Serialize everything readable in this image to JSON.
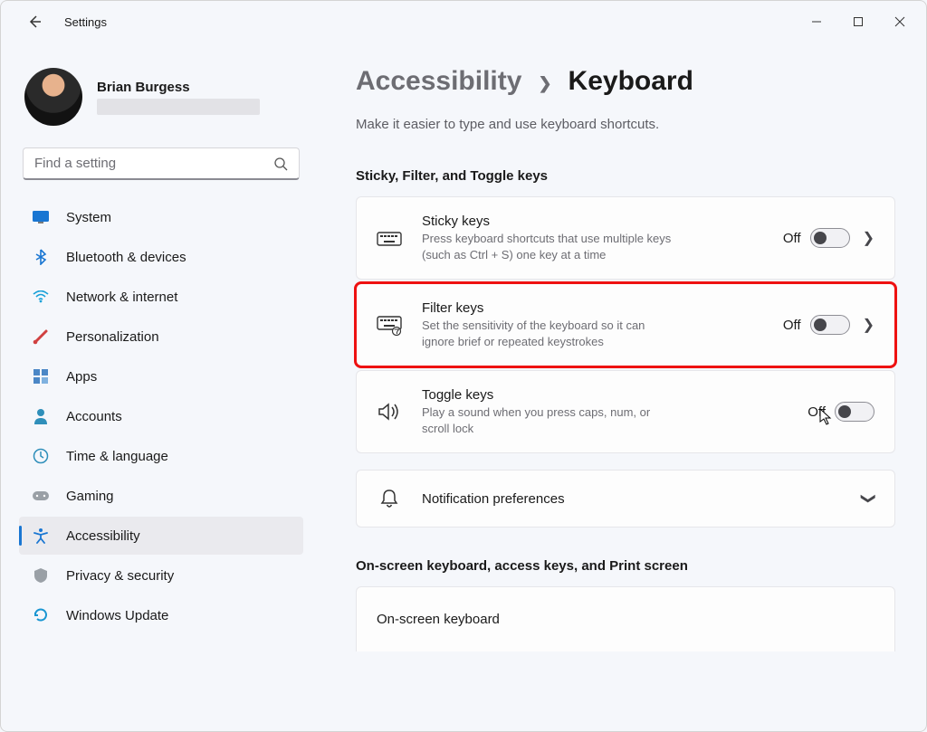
{
  "app_title": "Settings",
  "user": {
    "name": "Brian Burgess"
  },
  "search": {
    "placeholder": "Find a setting"
  },
  "nav": {
    "items": [
      {
        "label": "System"
      },
      {
        "label": "Bluetooth & devices"
      },
      {
        "label": "Network & internet"
      },
      {
        "label": "Personalization"
      },
      {
        "label": "Apps"
      },
      {
        "label": "Accounts"
      },
      {
        "label": "Time & language"
      },
      {
        "label": "Gaming"
      },
      {
        "label": "Accessibility"
      },
      {
        "label": "Privacy & security"
      },
      {
        "label": "Windows Update"
      }
    ]
  },
  "breadcrumb": {
    "prev": "Accessibility",
    "current": "Keyboard"
  },
  "subtitle": "Make it easier to type and use keyboard shortcuts.",
  "section1_title": "Sticky, Filter, and Toggle keys",
  "cards": {
    "sticky": {
      "title": "Sticky keys",
      "desc": "Press keyboard shortcuts that use multiple keys (such as Ctrl + S) one key at a time",
      "state": "Off"
    },
    "filter": {
      "title": "Filter keys",
      "desc": "Set the sensitivity of the keyboard so it can ignore brief or repeated keystrokes",
      "state": "Off"
    },
    "toggle": {
      "title": "Toggle keys",
      "desc": "Play a sound when you press caps, num, or scroll lock",
      "state": "Off"
    },
    "notif": {
      "title": "Notification preferences"
    }
  },
  "section2_title": "On-screen keyboard, access keys, and Print screen",
  "cards2": {
    "osk": {
      "title": "On-screen keyboard"
    }
  }
}
